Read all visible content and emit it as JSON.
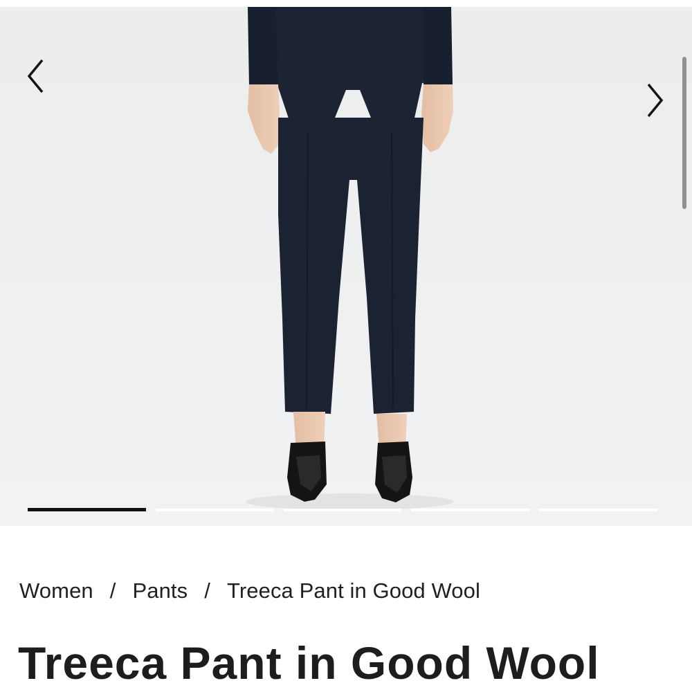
{
  "gallery": {
    "product_image_alt": "Model wearing navy Treeca Pant in Good Wool with black heels",
    "prev_icon": "chevron-left-icon",
    "next_icon": "chevron-right-icon",
    "slide_count": 5,
    "active_slide": 1,
    "colors": {
      "background": "#eeeff0",
      "garment": "#1b2333",
      "indicator_active": "#111213",
      "indicator_inactive": "#ffffff"
    }
  },
  "breadcrumb": {
    "items": [
      "Women",
      "Pants",
      "Treeca Pant in Good Wool"
    ],
    "separator": "/"
  },
  "product": {
    "title": "Treeca Pant in Good Wool"
  }
}
